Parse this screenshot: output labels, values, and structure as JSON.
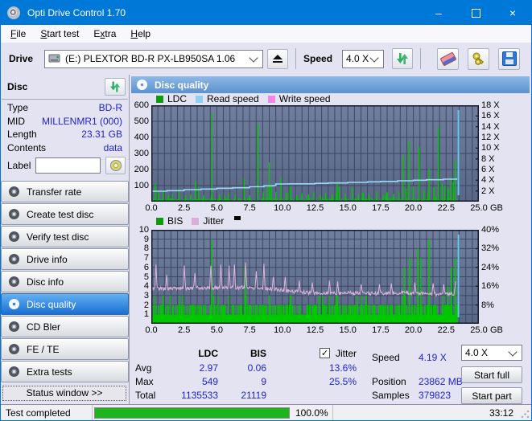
{
  "window": {
    "title": "Opti Drive Control 1.70"
  },
  "menu": {
    "items": [
      {
        "label": "File",
        "u": 0
      },
      {
        "label": "Start test",
        "u": 0
      },
      {
        "label": "Extra",
        "u": 1
      },
      {
        "label": "Help",
        "u": 0
      }
    ]
  },
  "toolbar": {
    "drive_label": "Drive",
    "drive_value": "(E:)   PLEXTOR BD-R  PX-LB950SA 1.06",
    "speed_label": "Speed",
    "speed_value": "4.0 X",
    "icons": [
      "drive-icon",
      "eject-icon",
      "refresh-icon",
      "eraser-icon",
      "keys-icon",
      "save-icon"
    ]
  },
  "sidebar": {
    "disc_header": "Disc",
    "fields": [
      {
        "label": "Type",
        "value": "BD-R"
      },
      {
        "label": "MID",
        "value": "MILLENMR1 (000)"
      },
      {
        "label": "Length",
        "value": "23.31 GB"
      },
      {
        "label": "Contents",
        "value": "data"
      }
    ],
    "label_field": {
      "label": "Label",
      "value": ""
    },
    "nav": [
      {
        "label": "Transfer rate",
        "selected": false
      },
      {
        "label": "Create test disc",
        "selected": false
      },
      {
        "label": "Verify test disc",
        "selected": false
      },
      {
        "label": "Drive info",
        "selected": false
      },
      {
        "label": "Disc info",
        "selected": false
      },
      {
        "label": "Disc quality",
        "selected": true
      },
      {
        "label": "CD Bler",
        "selected": false
      },
      {
        "label": "FE / TE",
        "selected": false
      },
      {
        "label": "Extra tests",
        "selected": false
      }
    ],
    "status_window": "Status window >>"
  },
  "main": {
    "header": "Disc quality",
    "stats": {
      "col_headers": [
        "LDC",
        "BIS"
      ],
      "jitter_label": "Jitter",
      "jitter_checked": true,
      "check_glyph": "✓",
      "rows": [
        {
          "label": "Avg",
          "ldc": "2.97",
          "bis": "0.06",
          "jitter": "13.6%"
        },
        {
          "label": "Max",
          "ldc": "549",
          "bis": "9",
          "jitter": "25.5%"
        },
        {
          "label": "Total",
          "ldc": "1135533",
          "bis": "21119",
          "jitter": ""
        }
      ],
      "speed_label": "Speed",
      "speed_value": "4.19 X",
      "position_label": "Position",
      "position_value": "23862 MB",
      "samples_label": "Samples",
      "samples_value": "379823",
      "speed_select": "4.0 X",
      "start_full": "Start full",
      "start_part": "Start part"
    }
  },
  "statusbar": {
    "text": "Test completed",
    "progress": "100.0%",
    "progress_value": 100,
    "time": "33:12"
  },
  "colors": {
    "titlebar": "#0078d7",
    "plot_bg_top": "#717f9f",
    "plot_bg_bottom": "#596786",
    "grid": "#3c4662",
    "plot_border": "#141a2b",
    "ldc_green": "#00c800",
    "read_speed_cyan": "#9bd8f6",
    "write_speed_magenta": "#f584e8",
    "jitter_pink": "#dfb3dc",
    "end_marker_cyan": "#6cc9f2",
    "value_blue": "#2323cc",
    "progress_green": "#1db41d",
    "selected_nav_blue": "#1a6ed2"
  },
  "chart_data": [
    {
      "type": "line",
      "title": "LDC errors and read/write speed vs disc position",
      "legend": [
        {
          "label": "LDC",
          "color": "#0e9a0e"
        },
        {
          "label": "Read speed",
          "color": "#8dd0f2"
        },
        {
          "label": "Write speed",
          "color": "#f584e8"
        }
      ],
      "xlim": [
        0,
        25
      ],
      "x_unit": "GB",
      "x_minor_step": 0.5,
      "x_tick_labels": [
        "0.0",
        "2.5",
        "5.0",
        "7.5",
        "10.0",
        "12.5",
        "15.0",
        "17.5",
        "20.0",
        "22.5",
        "25.0"
      ],
      "left_axis": {
        "lim": [
          0,
          600
        ],
        "ticks": [
          600,
          500,
          400,
          300,
          200,
          100
        ]
      },
      "right_axis": {
        "lim": [
          0,
          18
        ],
        "ticks": [
          18,
          16,
          14,
          12,
          10,
          8,
          6,
          4,
          2
        ],
        "tick_labels": [
          "18 X",
          "16 X",
          "14 X",
          "12 X",
          "10 X",
          "8 X",
          "6 X",
          "4 X",
          "2 X"
        ]
      },
      "data_end_gb": 23.35,
      "series": [
        {
          "name": "LDC",
          "draw": "spikes",
          "color": "#00c800",
          "axis": "left",
          "points": [
            [
              0.05,
              160
            ],
            [
              0.3,
              112
            ],
            [
              0.55,
              60
            ],
            [
              0.9,
              65
            ],
            [
              1.3,
              40
            ],
            [
              1.6,
              48
            ],
            [
              2.1,
              78
            ],
            [
              2.6,
              40
            ],
            [
              3.0,
              45
            ],
            [
              3.38,
              130
            ],
            [
              3.6,
              92
            ],
            [
              4.0,
              40
            ],
            [
              4.62,
              549
            ],
            [
              5.2,
              45
            ],
            [
              5.6,
              40
            ],
            [
              5.9,
              52
            ],
            [
              6.4,
              45
            ],
            [
              7.08,
              140
            ],
            [
              7.5,
              40
            ],
            [
              8.12,
              480
            ],
            [
              8.55,
              60
            ],
            [
              8.85,
              105
            ],
            [
              9.0,
              245
            ],
            [
              9.15,
              95
            ],
            [
              9.5,
              60
            ],
            [
              9.9,
              150
            ],
            [
              10.3,
              55
            ],
            [
              10.65,
              95
            ],
            [
              11.1,
              45
            ],
            [
              11.5,
              52
            ],
            [
              12.0,
              45
            ],
            [
              12.4,
              60
            ],
            [
              12.9,
              42
            ],
            [
              13.3,
              55
            ],
            [
              13.8,
              45
            ],
            [
              14.18,
              115
            ],
            [
              14.35,
              92
            ],
            [
              14.8,
              48
            ],
            [
              15.35,
              88
            ],
            [
              15.8,
              45
            ],
            [
              16.1,
              58
            ],
            [
              16.6,
              45
            ],
            [
              17.2,
              62
            ],
            [
              17.7,
              45
            ],
            [
              18.0,
              58
            ],
            [
              18.5,
              48
            ],
            [
              18.9,
              60
            ],
            [
              19.2,
              285
            ],
            [
              19.45,
              80
            ],
            [
              19.65,
              375
            ],
            [
              20.0,
              95
            ],
            [
              20.45,
              340
            ],
            [
              20.8,
              70
            ],
            [
              21.2,
              205
            ],
            [
              21.55,
              90
            ],
            [
              21.9,
              460
            ],
            [
              22.2,
              110
            ],
            [
              22.4,
              100
            ],
            [
              22.65,
              80
            ],
            [
              22.85,
              150
            ],
            [
              23.05,
              120
            ],
            [
              23.2,
              260
            ]
          ],
          "noise": {
            "seed": 11,
            "step": 0.07,
            "base": 3,
            "amp": 20,
            "burst_p": 0.055,
            "burst_amp": 55
          }
        },
        {
          "name": "Read speed",
          "draw": "stepline",
          "color": "#9bd8f6",
          "axis": "right",
          "points": [
            [
              0,
              1.95
            ],
            [
              1.2,
              2.05
            ],
            [
              2.5,
              2.25
            ],
            [
              3.8,
              2.35
            ],
            [
              5,
              2.5
            ],
            [
              6.2,
              2.6
            ],
            [
              7.5,
              2.8
            ],
            [
              8.6,
              2.95
            ],
            [
              9.3,
              3.0
            ],
            [
              9.5,
              3.3
            ],
            [
              10.5,
              3.33
            ],
            [
              12.5,
              3.42
            ],
            [
              13.5,
              3.5
            ],
            [
              15,
              3.6
            ],
            [
              16.5,
              3.7
            ],
            [
              17.5,
              3.78
            ],
            [
              18.8,
              3.9
            ],
            [
              20,
              4.0
            ],
            [
              21,
              4.1
            ],
            [
              22.3,
              4.2
            ],
            [
              23.3,
              4.35
            ]
          ]
        },
        {
          "name": "Write speed",
          "draw": "none",
          "color": "#f584e8",
          "axis": "right",
          "points": []
        }
      ],
      "end_marker_color": "#6cc9f2"
    },
    {
      "type": "line",
      "title": "BIS errors and jitter vs disc position",
      "legend": [
        {
          "label": "BIS",
          "color": "#0e9a0e"
        },
        {
          "label": "Jitter",
          "color": "#d9aed9"
        }
      ],
      "legend_mark_color": "#000000",
      "xlim": [
        0,
        25
      ],
      "x_unit": "GB",
      "x_minor_step": 0.5,
      "x_tick_labels": [
        "0.0",
        "2.5",
        "5.0",
        "7.5",
        "10.0",
        "12.5",
        "15.0",
        "17.5",
        "20.0",
        "22.5",
        "25.0"
      ],
      "left_axis": {
        "lim": [
          0,
          10
        ],
        "ticks": [
          10,
          9,
          8,
          7,
          6,
          5,
          4,
          3,
          2,
          1
        ]
      },
      "right_axis": {
        "lim": [
          0,
          40
        ],
        "ticks": [
          40,
          32,
          24,
          16,
          8
        ],
        "tick_labels": [
          "40%",
          "32%",
          "24%",
          "16%",
          "8%"
        ]
      },
      "data_end_gb": 23.35,
      "series": [
        {
          "name": "BIS",
          "draw": "bars",
          "color": "#00c800",
          "axis": "left",
          "baseline": 1,
          "points": [
            [
              0.9,
              3
            ],
            [
              4.6,
              9
            ],
            [
              7.15,
              6
            ],
            [
              9.0,
              3
            ],
            [
              10.6,
              3
            ],
            [
              12.8,
              3
            ],
            [
              14.2,
              3
            ],
            [
              16.4,
              3
            ],
            [
              19.3,
              6
            ],
            [
              19.7,
              7
            ],
            [
              20.35,
              8
            ],
            [
              20.55,
              7
            ],
            [
              21.2,
              9
            ],
            [
              22.6,
              4
            ],
            [
              22.9,
              6
            ],
            [
              23.2,
              7
            ]
          ],
          "noise": {
            "seed": 23,
            "step": 0.055,
            "p2": 0.5,
            "p3": 0.025
          }
        },
        {
          "name": "Jitter",
          "draw": "noisyline",
          "color": "#dfb3dc",
          "axis": "left",
          "trend": [
            [
              0,
              3.8
            ],
            [
              1,
              3.75
            ],
            [
              3,
              3.8
            ],
            [
              5,
              3.85
            ],
            [
              7,
              3.85
            ],
            [
              9,
              3.75
            ],
            [
              9.8,
              3.6
            ],
            [
              10.8,
              3.45
            ],
            [
              12,
              3.3
            ],
            [
              13,
              3.25
            ],
            [
              15,
              3.3
            ],
            [
              17,
              3.2
            ],
            [
              19,
              3.3
            ],
            [
              21,
              3.2
            ],
            [
              22.5,
              3.1
            ],
            [
              23.3,
              3.25
            ]
          ],
          "spikes": [
            [
              0.35,
              6.3
            ],
            [
              1.15,
              5.2
            ],
            [
              2.5,
              6.2
            ],
            [
              3.35,
              5.4
            ],
            [
              4.55,
              6.2
            ],
            [
              5.3,
              6.3
            ],
            [
              5.95,
              6.2
            ],
            [
              6.35,
              6.3
            ],
            [
              7.2,
              6.5
            ],
            [
              8.0,
              5.6
            ],
            [
              8.6,
              6.4
            ],
            [
              9.3,
              5.0
            ],
            [
              10.2,
              5.0
            ],
            [
              11.3,
              4.6
            ],
            [
              12.3,
              4.4
            ],
            [
              13.6,
              4.6
            ],
            [
              14.2,
              4.5
            ],
            [
              16.0,
              4.2
            ],
            [
              17.4,
              4.2
            ],
            [
              18.3,
              4.3
            ],
            [
              20.1,
              4.4
            ],
            [
              21.5,
              4.3
            ],
            [
              22.3,
              4.2
            ],
            [
              23.2,
              4.5
            ]
          ],
          "noise": {
            "seed": 5,
            "step": 0.045,
            "amp": 0.4
          }
        }
      ],
      "end_marker_color": "#6cc9f2",
      "stats": {
        "jitter_avg": "13.6%",
        "jitter_max": "25.5%",
        "bis_avg": "0.06",
        "bis_max": "9",
        "bis_total": "21119"
      }
    }
  ]
}
